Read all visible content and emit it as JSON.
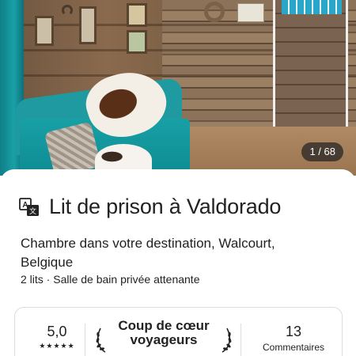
{
  "photo": {
    "counter": "1 / 68"
  },
  "listing": {
    "title": "Lit de prison à Valdorado",
    "subtitle": "Chambre dans votre destination, Walcourt, Belgique",
    "details": "2 lits · Salle de bain privée attenante"
  },
  "stats": {
    "rating": "5,0",
    "stars": "★★★★★",
    "favorite_label": "Coup de cœur voyageurs",
    "reviews_count": "13",
    "reviews_label": "Commentaires"
  },
  "icons": {
    "translate": "translate-icon",
    "laurel": "laurel-icon"
  },
  "colors": {
    "text": "#222222",
    "border": "#dddddd",
    "counter_bg": "#222222"
  }
}
